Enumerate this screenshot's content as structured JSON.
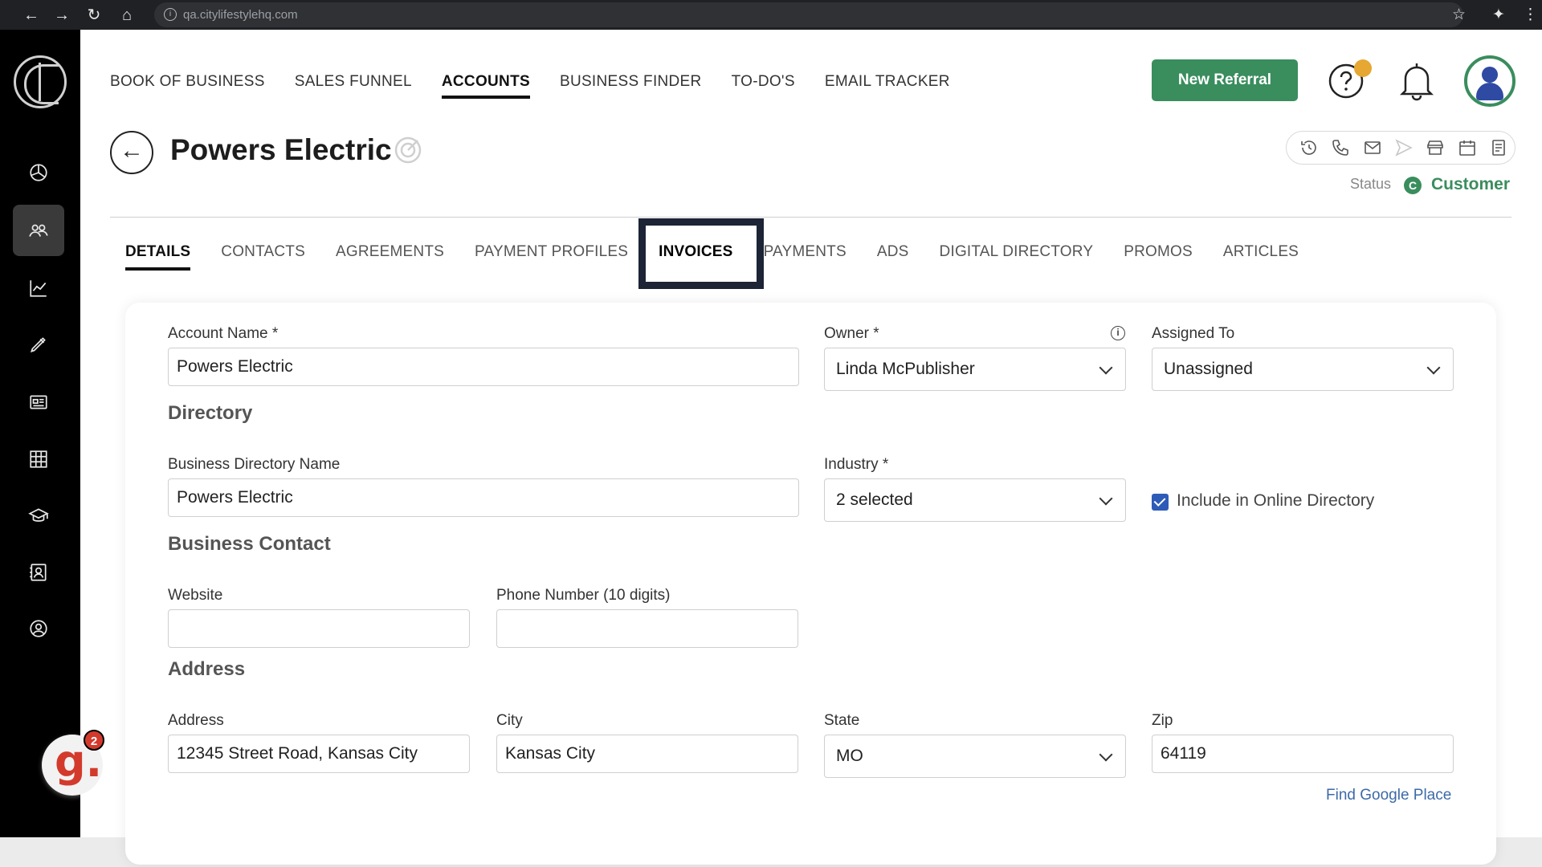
{
  "browser": {
    "url": "qa.citylifestylehq.com"
  },
  "top_nav": [
    {
      "label": "BOOK OF BUSINESS"
    },
    {
      "label": "SALES FUNNEL"
    },
    {
      "label": "ACCOUNTS"
    },
    {
      "label": "BUSINESS FINDER"
    },
    {
      "label": "TO-DO'S"
    },
    {
      "label": "EMAIL TRACKER"
    }
  ],
  "header": {
    "new_referral_label": "New Referral",
    "page_title": "Powers Electric",
    "status_label": "Status",
    "status_badge": "C",
    "status_value": "Customer",
    "brand_green": "#3a8d5d"
  },
  "sidebar": {
    "icons": [
      "dashboard-icon",
      "accounts-icon",
      "analytics-icon",
      "pen-icon",
      "news-icon",
      "grid-icon",
      "education-icon",
      "contacts-book-icon",
      "user-circle-icon"
    ],
    "chat_badge_letter": "g.",
    "chat_badge_count": "2"
  },
  "tabs": [
    {
      "label": "DETAILS"
    },
    {
      "label": "CONTACTS"
    },
    {
      "label": "AGREEMENTS"
    },
    {
      "label": "PAYMENT PROFILES"
    },
    {
      "label": "INVOICES"
    },
    {
      "label": "PAYMENTS"
    },
    {
      "label": "ADS"
    },
    {
      "label": "DIGITAL DIRECTORY"
    },
    {
      "label": "PROMOS"
    },
    {
      "label": "ARTICLES"
    }
  ],
  "form": {
    "account_name_label": "Account Name *",
    "account_name_value": "Powers Electric",
    "owner_label": "Owner *",
    "owner_value": "Linda McPublisher",
    "assigned_label": "Assigned To",
    "assigned_value": "Unassigned",
    "directory_section": "Directory",
    "bdn_label": "Business Directory Name",
    "bdn_value": "Powers Electric",
    "industry_label": "Industry *",
    "industry_value": "2 selected",
    "include_label": "Include in Online Directory",
    "contact_section": "Business Contact",
    "website_label": "Website",
    "website_value": "",
    "phone_label": "Phone Number (10 digits)",
    "phone_value": "",
    "address_section": "Address",
    "address_label": "Address",
    "address_value": "12345 Street Road, Kansas City",
    "city_label": "City",
    "city_value": "Kansas City",
    "state_label": "State",
    "state_value": "MO",
    "zip_label": "Zip",
    "zip_value": "64119",
    "find_google_place": "Find Google Place"
  }
}
